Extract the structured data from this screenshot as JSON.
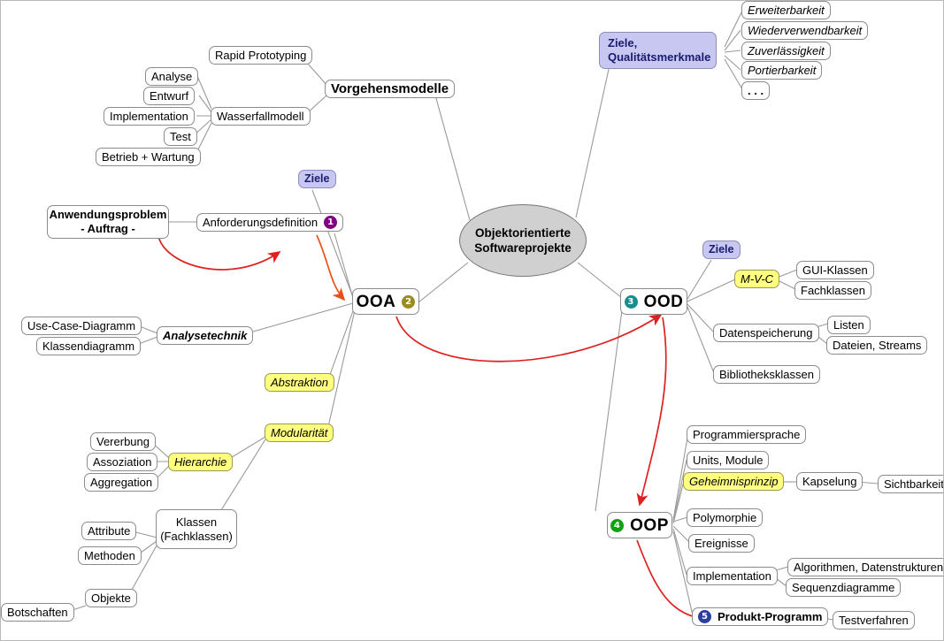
{
  "diagram": {
    "title": "Objektorientierte Softwareprojekte",
    "center": {
      "label": "Objektorientierte\nSoftwareprojekte"
    },
    "colors": {
      "node_border": "#8c8c8c",
      "highlight_yellow": "#ffff80",
      "goal_lavender": "#c7c7f2",
      "center_gray": "#d0d0d0",
      "arrow_red": "#e02020",
      "arrow_orange": "#e85018",
      "connector_gray": "#9a9a9a"
    },
    "badges": {
      "one": {
        "text": "1",
        "color": "#800080"
      },
      "two": {
        "text": "2",
        "color": "#9a8c1e"
      },
      "three": {
        "text": "3",
        "color": "#1a8c8c"
      },
      "four": {
        "text": "4",
        "color": "#11a011"
      },
      "five": {
        "text": "5",
        "color": "#2a3f9e"
      }
    },
    "nodes": {
      "rapid_prototyping": "Rapid Prototyping",
      "analyse": "Analyse",
      "entwurf": "Entwurf",
      "implementation_left": "Implementation",
      "test": "Test",
      "betrieb_wartung": "Betrieb + Wartung",
      "wasserfallmodell": "Wasserfallmodell",
      "vorgehensmodelle": "Vorgehensmodelle",
      "ziele_qualitaetsmerkmale": "Ziele,\nQualitätsmerkmale",
      "erweiterbarkeit": "Erweiterbarkeit",
      "wiederverwendbarkeit": "Wiederverwendbarkeit",
      "zuverlaessigkeit": "Zuverlässigkeit",
      "portierbarkeit": "Portierbarkeit",
      "ellipsis": ". . .",
      "ziele_ooa": "Ziele",
      "anwendungsproblem": "Anwendungsproblem\n- Auftrag -",
      "anforderungsdefinition": "Anforderungsdefinition",
      "ooa": "OOA",
      "use_case_diagramm": "Use-Case-Diagramm",
      "klassendiagramm": "Klassendiagramm",
      "analysetechnik": "Analysetechnik",
      "abstraktion": "Abstraktion",
      "modularitaet": "Modularität",
      "hierarchie": "Hierarchie",
      "vererbung": "Vererbung",
      "assoziation": "Assoziation",
      "aggregation": "Aggregation",
      "attribute": "Attribute",
      "methoden": "Methoden",
      "klassen_fachklassen": "Klassen\n(Fachklassen)",
      "objekte": "Objekte",
      "botschaften": "Botschaften",
      "ood": "OOD",
      "ziele_ood": "Ziele",
      "mvc": "M-V-C",
      "gui_klassen": "GUI-Klassen",
      "fachklassen": "Fachklassen",
      "datenspeicherung": "Datenspeicherung",
      "listen": "Listen",
      "dateien_streams": "Dateien, Streams",
      "bibliotheksklassen": "Bibliotheksklassen",
      "oop": "OOP",
      "programmiersprache": "Programmiersprache",
      "units_module": "Units, Module",
      "geheimnisprinzip": "Geheimnisprinzip",
      "kapselung": "Kapselung",
      "sichtbarkeit": "Sichtbarkeit",
      "polymorphie": "Polymorphie",
      "ereignisse": "Ereignisse",
      "implementation_right": "Implementation",
      "algorithmen_datenstrukturen": "Algorithmen, Datenstrukturen",
      "sequenzdiagramme": "Sequenzdiagramme",
      "produkt_programm": "Produkt-Programm",
      "testverfahren": "Testverfahren"
    }
  }
}
